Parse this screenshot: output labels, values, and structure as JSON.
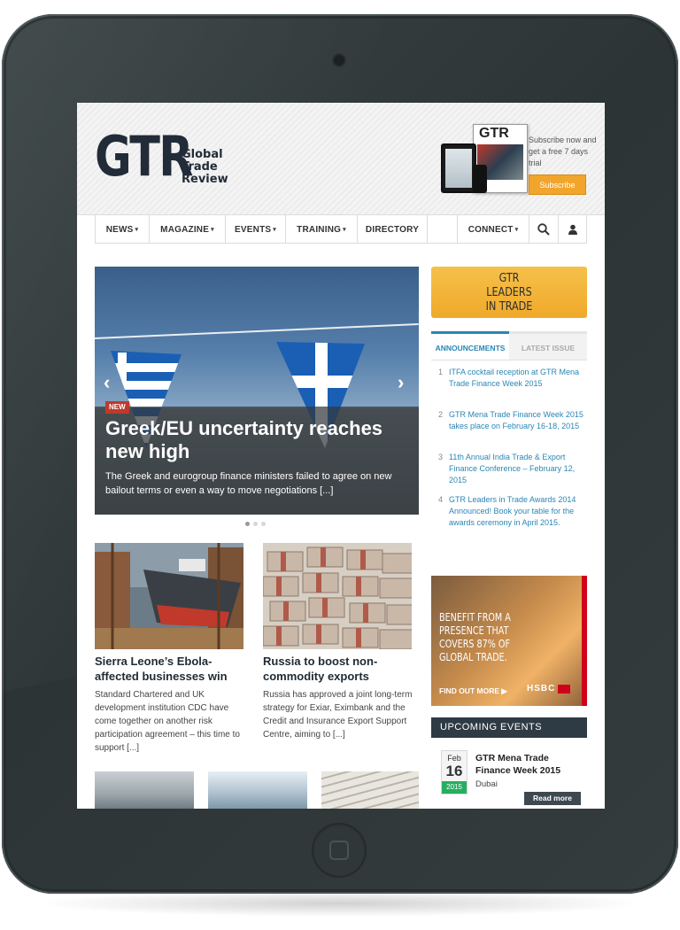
{
  "header": {
    "logo_main": "GTR",
    "logo_line1": "Global",
    "logo_line2": "Trade",
    "logo_line3": "Review",
    "promo_mag_title": "GTR",
    "subscribe_text": "Subscribe now and get a free 7 days trial",
    "subscribe_button": "Subscribe"
  },
  "nav": {
    "news": "NEWS",
    "magazine": "MAGAZINE",
    "events": "EVENTS",
    "training": "TRAINING",
    "directory": "DIRECTORY",
    "connect": "CONNECT",
    "caret": "▾"
  },
  "hero": {
    "badge": "NEW",
    "title": "Greek/EU uncertainty reaches new high",
    "text": "The Greek and eurogroup finance ministers failed to agree on new bailout terms or even a way to move negotiations [...]",
    "prev_icon": "chevron-left-icon",
    "next_icon": "chevron-right-icon",
    "prev_glyph": "‹",
    "next_glyph": "›",
    "active_slide": 1,
    "slide_count": 3
  },
  "articles": [
    {
      "title": "Sierra Leone’s Ebola-affected businesses win",
      "text": "Standard Chartered and UK development institution CDC have come together on another risk participation agreement – this time to support [...]"
    },
    {
      "title": "Russia to boost non-commodity exports",
      "text": "Russia has approved a joint long-term strategy for Exiar, Eximbank and the Credit and Insurance Export Support Centre, aiming to [...]"
    }
  ],
  "sidebar": {
    "leaders_line1": "GTR",
    "leaders_line2": "LEADERS",
    "leaders_line3": "IN TRADE",
    "tab_announcements": "ANNOUNCEMENTS",
    "tab_latest_issue": "LATEST ISSUE",
    "announcements": [
      {
        "num": "1",
        "text": "ITFA cocktail reception at GTR Mena Trade Finance Week 2015"
      },
      {
        "num": "2",
        "text": "GTR Mena Trade Finance Week 2015 takes place on February 16-18, 2015"
      },
      {
        "num": "3",
        "text": "11th Annual India Trade & Export Finance Conference – February 12, 2015"
      },
      {
        "num": "4",
        "text": "GTR Leaders in Trade Awards 2014 Announced! Book your table for the awards ceremony in April 2015."
      }
    ],
    "ad": {
      "headline": "BENEFIT FROM A PRESENCE THAT COVERS 87% OF GLOBAL TRADE.",
      "find_out": "FIND OUT MORE",
      "find_out_icon": "▶",
      "brand": "HSBC"
    },
    "upcoming_events_title": "UPCOMING EVENTS",
    "event": {
      "month": "Feb",
      "day": "16",
      "year": "2015",
      "title": "GTR Mena Trade Finance Week 2015",
      "location": "Dubai",
      "read_more": "Read more"
    }
  },
  "colors": {
    "brand_navy": "#222c38",
    "accent_orange": "#f2a52b",
    "link_blue": "#2a86b5",
    "badge_red": "#c0392b",
    "event_green": "#27ae60",
    "tablet_body": "#343c3e"
  }
}
